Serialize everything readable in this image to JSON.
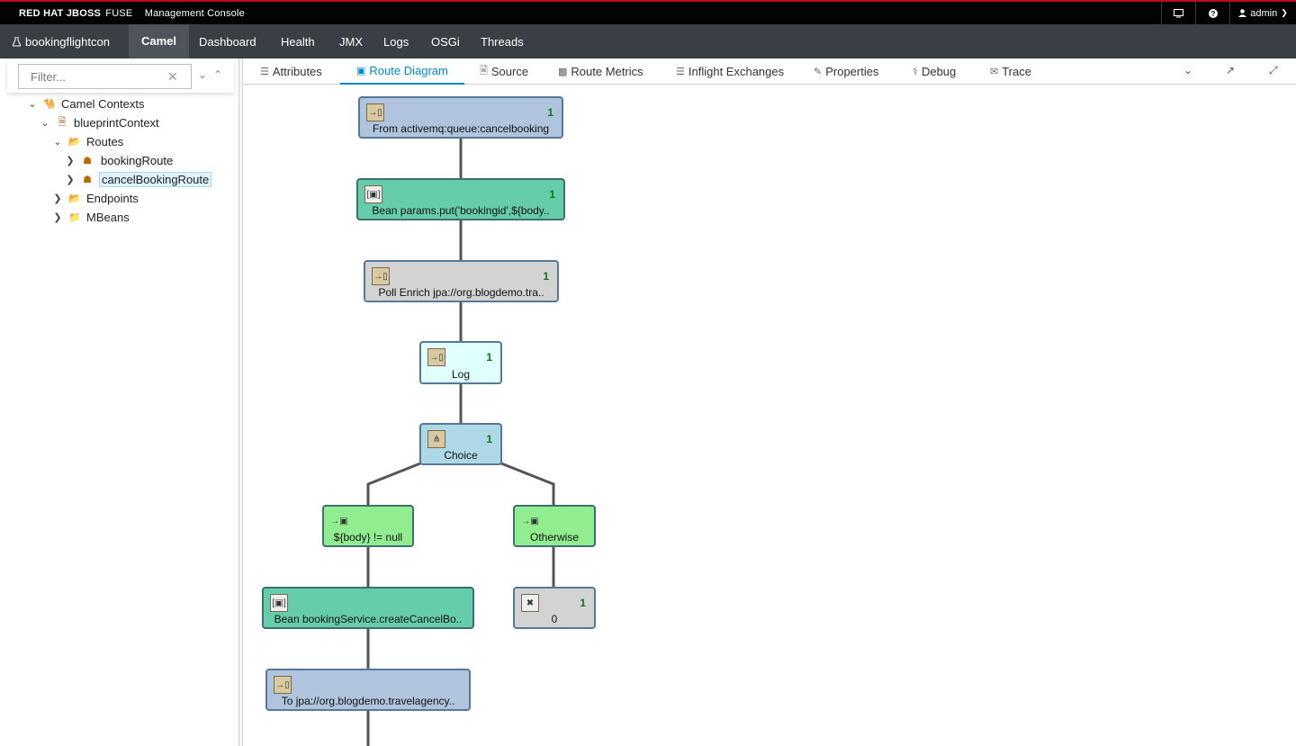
{
  "header": {
    "brand_redhat": "RED HAT JBOSS",
    "brand_fuse": "FUSE",
    "console_title": "Management Console",
    "user": "admin",
    "monitor_icon": "monitor-icon",
    "help_icon": "help-icon"
  },
  "nav": {
    "context": "bookingflightcon",
    "items": [
      "Camel",
      "Dashboard",
      "Health",
      "JMX",
      "Logs",
      "OSGi",
      "Threads"
    ],
    "active": "Camel"
  },
  "sidebar": {
    "filter_placeholder": "Filter...",
    "tree": {
      "camel_contexts": "Camel Contexts",
      "blueprint_context": "blueprintContext",
      "routes": "Routes",
      "booking_route": "bookingRoute",
      "cancel_booking_route": "cancelBookingRoute",
      "endpoints": "Endpoints",
      "mbeans": "MBeans"
    }
  },
  "tabs": {
    "attributes": "Attributes",
    "route_diagram": "Route Diagram",
    "source": "Source",
    "route_metrics": "Route Metrics",
    "inflight_exchanges": "Inflight Exchanges",
    "properties": "Properties",
    "debug": "Debug",
    "trace": "Trace",
    "active": "Route Diagram"
  },
  "diagram": {
    "nodes": {
      "from": {
        "label": "From activemq:queue:cancelbooking",
        "count": "1"
      },
      "bean1": {
        "label": "Bean params.put('bookingid',${body..",
        "count": "1"
      },
      "poll": {
        "label": "Poll Enrich jpa://org.blogdemo.tra..",
        "count": "1"
      },
      "log": {
        "label": "Log",
        "count": "1"
      },
      "choice": {
        "label": "Choice",
        "count": "1"
      },
      "when": {
        "label": "${body} != null",
        "count": ""
      },
      "otherwise": {
        "label": "Otherwise",
        "count": ""
      },
      "bean2": {
        "label": "Bean bookingService.createCancelBo..",
        "count": ""
      },
      "stop": {
        "label": "0",
        "count": "1"
      },
      "to": {
        "label": "To jpa://org.blogdemo.travelagency..",
        "count": ""
      }
    }
  },
  "colors": {
    "brand_bar": "#030303",
    "nav_bar": "#393f44",
    "accent": "#0088ce",
    "from_node": "#b0c4de",
    "bean_node": "#66cdaa",
    "poll_node": "#d3d3d3",
    "log_node": "#e0ffff",
    "choice_node": "#add8e6",
    "when_node": "#90ee90",
    "count_text": "#0a7a0a"
  }
}
